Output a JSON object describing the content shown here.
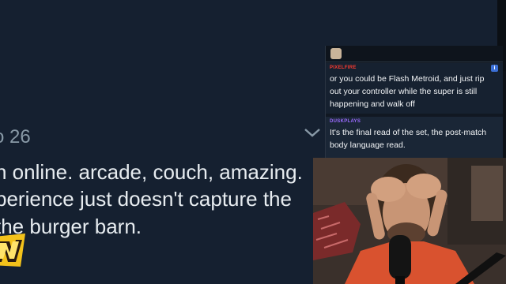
{
  "tweet": {
    "date_fragment": "o 26",
    "lines": [
      "n online.  arcade, couch, amazing.",
      "perience just doesn't capture the",
      " the burger barn."
    ]
  },
  "chat": {
    "messages": [
      {
        "user": "PIXELFIRE",
        "text": "or you could be Flash Metroid, and just rip out your controller while the super is still happening and walk off",
        "badge": "i"
      },
      {
        "user": "DUSKPLAYS",
        "text": "It's the final read of the set, the post-match body language read."
      }
    ]
  },
  "colors": {
    "background": "#152030",
    "tweet_text": "#e7ecf0",
    "date_text": "#8899a6",
    "chat_bg": "#111822",
    "user1": "#ff3b30",
    "user2": "#9b6bff",
    "shirt": "#d9522f"
  },
  "icons": {
    "chevron": "chevron-down-icon",
    "avatar": "chat-avatar-icon",
    "info": "info-icon"
  }
}
